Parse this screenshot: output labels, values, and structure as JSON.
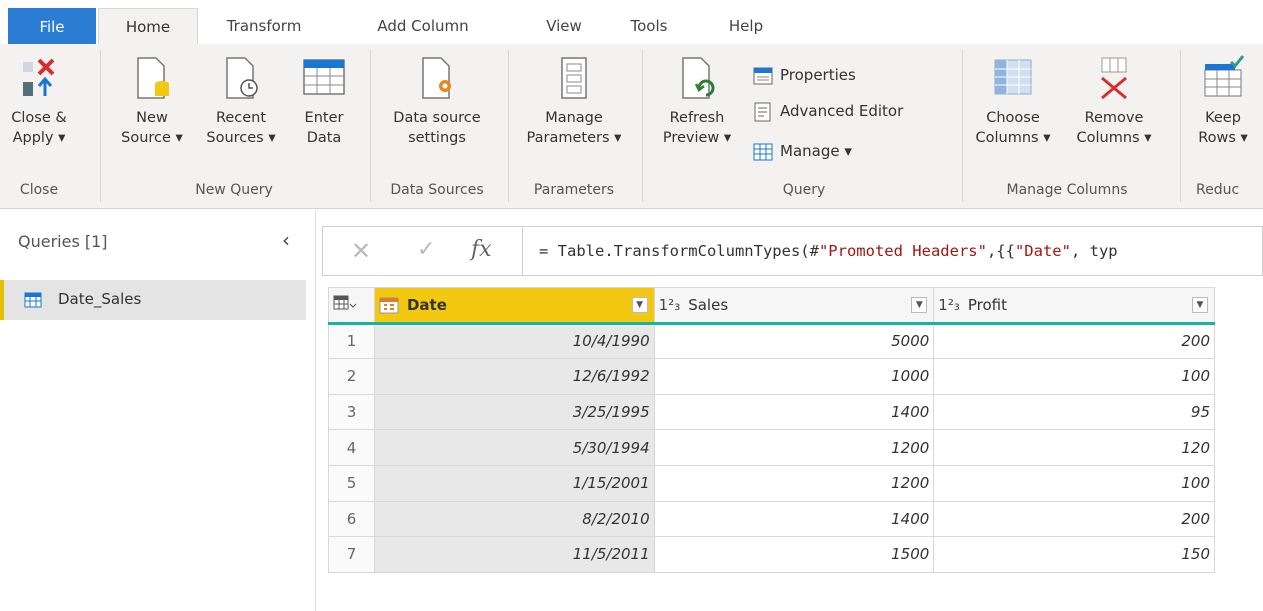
{
  "tabs": [
    "File",
    "Home",
    "Transform",
    "Add Column",
    "View",
    "Tools",
    "Help"
  ],
  "ribbon": {
    "close_apply": [
      "Close &",
      "Apply ▾"
    ],
    "new_source": [
      "New",
      "Source ▾"
    ],
    "recent_sources": [
      "Recent",
      "Sources ▾"
    ],
    "enter_data": [
      "Enter",
      "Data"
    ],
    "data_source_settings": [
      "Data source",
      "settings"
    ],
    "manage_parameters": [
      "Manage",
      "Parameters ▾"
    ],
    "refresh_preview": [
      "Refresh",
      "Preview ▾"
    ],
    "properties": "Properties",
    "advanced_editor": "Advanced Editor",
    "manage": "Manage ▾",
    "choose_columns": [
      "Choose",
      "Columns ▾"
    ],
    "remove_columns": [
      "Remove",
      "Columns ▾"
    ],
    "keep_rows": [
      "Keep",
      "Rows ▾"
    ],
    "groups": {
      "close": "Close",
      "new_query": "New Query",
      "data_sources": "Data Sources",
      "parameters": "Parameters",
      "query": "Query",
      "manage_columns": "Manage Columns",
      "reduce": "Reduc"
    }
  },
  "queries": {
    "header": "Queries [1]",
    "items": [
      "Date_Sales"
    ]
  },
  "formula": {
    "prefix": "= Table.TransformColumnTypes(#",
    "s1": "\"Promoted Headers\"",
    "mid": ",{{",
    "s2": "\"Date\"",
    "suffix": ", typ"
  },
  "grid": {
    "columns": [
      {
        "type": "",
        "name": "Date"
      },
      {
        "type": "1²₃",
        "name": "Sales"
      },
      {
        "type": "1²₃",
        "name": "Profit"
      }
    ],
    "rows": [
      {
        "n": "1",
        "date": "10/4/1990",
        "sales": "5000",
        "profit": "200"
      },
      {
        "n": "2",
        "date": "12/6/1992",
        "sales": "1000",
        "profit": "100"
      },
      {
        "n": "3",
        "date": "3/25/1995",
        "sales": "1400",
        "profit": "95"
      },
      {
        "n": "4",
        "date": "5/30/1994",
        "sales": "1200",
        "profit": "120"
      },
      {
        "n": "5",
        "date": "1/15/2001",
        "sales": "1200",
        "profit": "100"
      },
      {
        "n": "6",
        "date": "8/2/2010",
        "sales": "1400",
        "profit": "200"
      },
      {
        "n": "7",
        "date": "11/5/2011",
        "sales": "1500",
        "profit": "150"
      }
    ]
  }
}
